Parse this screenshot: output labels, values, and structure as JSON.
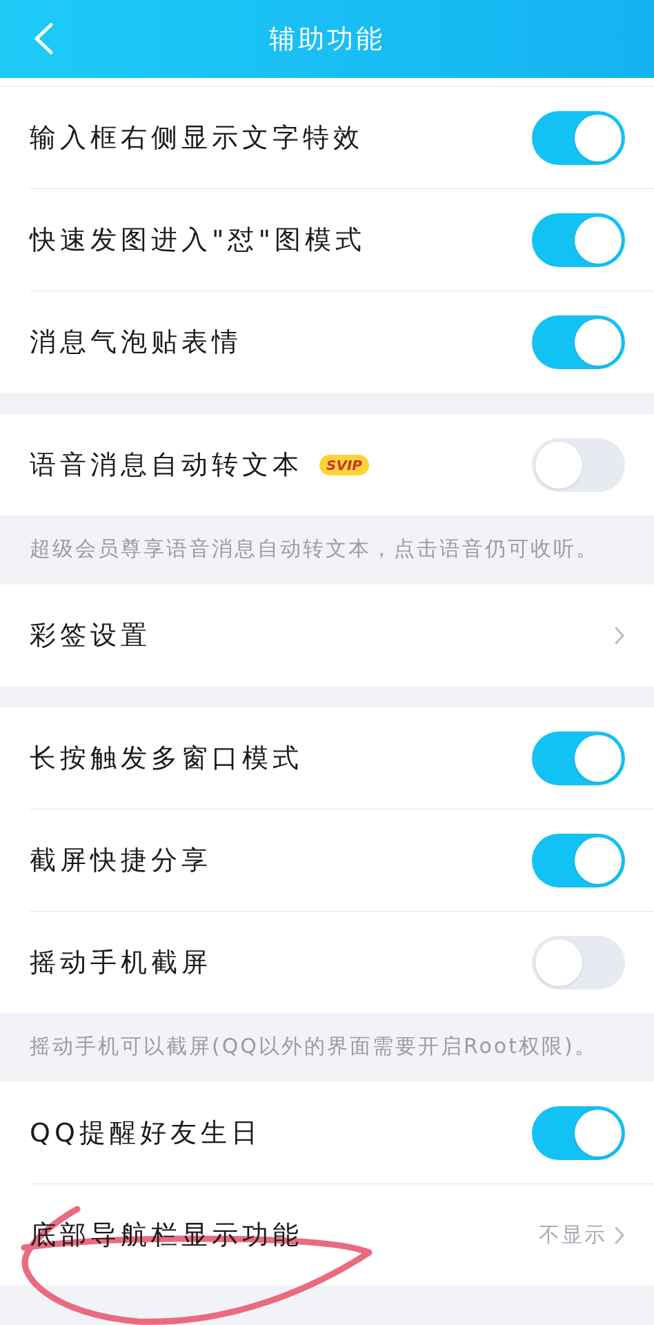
{
  "header": {
    "title": "辅助功能"
  },
  "groups": [
    {
      "items": [
        {
          "kind": "toggle",
          "label": "输入框右侧显示文字特效",
          "on": true
        },
        {
          "kind": "toggle",
          "label": "快速发图进入\"怼\"图模式",
          "on": true
        },
        {
          "kind": "toggle",
          "label": "消息气泡贴表情",
          "on": true
        }
      ]
    },
    {
      "items": [
        {
          "kind": "toggle",
          "label": "语音消息自动转文本",
          "badge": "SVIP",
          "on": false
        }
      ],
      "note": "超级会员尊享语音消息自动转文本，点击语音仍可收听。"
    },
    {
      "items": [
        {
          "kind": "link",
          "label": "彩签设置"
        }
      ]
    },
    {
      "items": [
        {
          "kind": "toggle",
          "label": "长按触发多窗口模式",
          "on": true
        },
        {
          "kind": "toggle",
          "label": "截屏快捷分享",
          "on": true
        },
        {
          "kind": "toggle",
          "label": "摇动手机截屏",
          "on": false
        }
      ],
      "note": "摇动手机可以截屏(QQ以外的界面需要开启Root权限)。"
    },
    {
      "items": [
        {
          "kind": "toggle",
          "label": "QQ提醒好友生日",
          "on": true
        },
        {
          "kind": "link",
          "label": "底部导航栏显示功能",
          "value": "不显示"
        }
      ]
    }
  ]
}
